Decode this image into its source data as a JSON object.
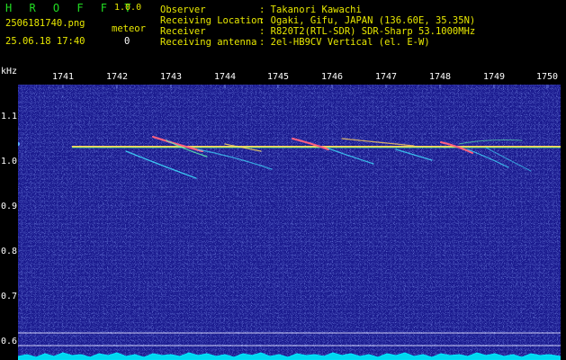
{
  "app": {
    "name": "H R O F F T",
    "version": "1.0.0"
  },
  "file": {
    "name": "2506181740.png",
    "datetime": "25.06.18 17:40"
  },
  "meteor": {
    "label": "meteor",
    "count": "0"
  },
  "info": [
    {
      "key": "Observer",
      "value": ": Takanori Kawachi"
    },
    {
      "key": "Receiving Location",
      "value": ": Ogaki, Gifu, JAPAN (136.60E, 35.35N)"
    },
    {
      "key": "Receiver",
      "value": ": R820T2(RTL-SDR) SDR-Sharp 53.1000MHz"
    },
    {
      "key": "Receiving antenna",
      "value": ": 2el-HB9CV Vertical (el. E-W)"
    }
  ],
  "axis": {
    "unit": "kHz",
    "x_ticks": [
      "1741",
      "1742",
      "1743",
      "1744",
      "1745",
      "1746",
      "1747",
      "1748",
      "1749",
      "1750"
    ],
    "y_ticks": [
      "1.1",
      "1.0",
      "0.9",
      "0.8",
      "0.7",
      "0.6"
    ]
  },
  "colors": {
    "background": "#1a1a8e",
    "carrier": "#ffd060",
    "meteor_trail": "#40e0ff",
    "noise_floor": "#00e5ff"
  }
}
